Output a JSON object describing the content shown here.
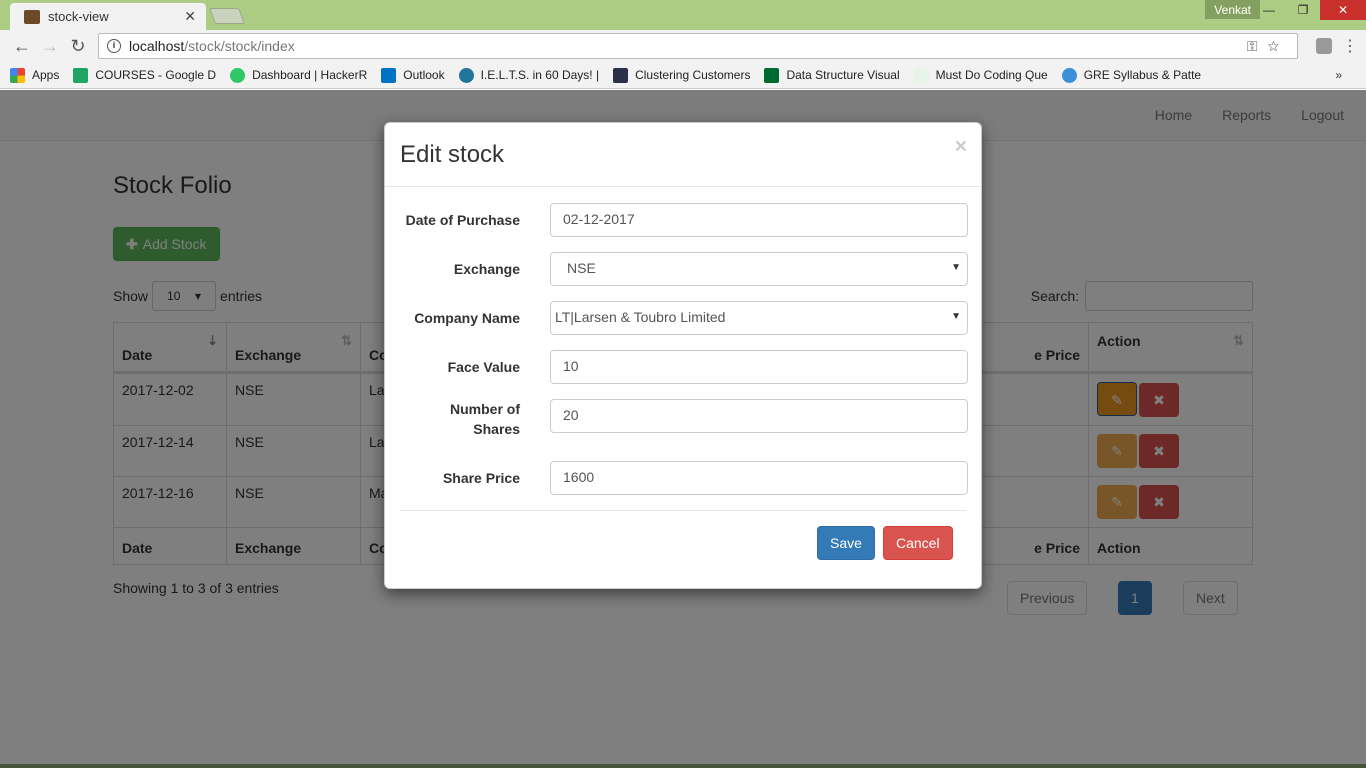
{
  "browser": {
    "tab_title": "stock-view",
    "user": "Venkat",
    "url_host": "localhost",
    "url_path": "/stock/stock/index",
    "bookmarks": [
      {
        "label": "Apps",
        "color": "#e94235"
      },
      {
        "label": "COURSES - Google D",
        "color": "#1fa463"
      },
      {
        "label": "Dashboard | HackerR",
        "color": "#2ec866"
      },
      {
        "label": "Outlook",
        "color": "#0072c6"
      },
      {
        "label": "I.E.L.T.S. in 60 Days! |",
        "color": "#21759b"
      },
      {
        "label": "Clustering Customers",
        "color": "#2a2f4a"
      },
      {
        "label": "Data Structure Visual",
        "color": "#006a33"
      },
      {
        "label": "Must Do Coding Que",
        "color": "#2f8d46"
      },
      {
        "label": "GRE Syllabus & Patte",
        "color": "#3a8fd8"
      }
    ],
    "more": "»"
  },
  "navbar": {
    "links": [
      "Home",
      "Reports",
      "Logout"
    ]
  },
  "page": {
    "title": "Stock Folio",
    "add_label": "Add Stock",
    "show_label": "Show",
    "entries_label": "entries",
    "page_length": "10",
    "search_label": "Search:"
  },
  "table": {
    "headers": [
      "Date",
      "Exchange",
      "Co",
      "e Price",
      "Action"
    ],
    "rows": [
      [
        "2017-12-02",
        "NSE",
        "La"
      ],
      [
        "2017-12-14",
        "NSE",
        "La"
      ],
      [
        "2017-12-16",
        "NSE",
        "Ma"
      ]
    ],
    "info": "Showing 1 to 3 of 3 entries",
    "pagination": {
      "previous": "Previous",
      "current": "1",
      "next": "Next"
    }
  },
  "modal": {
    "title": "Edit stock",
    "close": "×",
    "fields": [
      {
        "label": "Date of Purchase",
        "value": "02-12-2017"
      },
      {
        "label": "Exchange",
        "value": "NSE"
      },
      {
        "label": "Company Name",
        "value": "LT|Larsen & Toubro Limited"
      },
      {
        "label": "Face Value",
        "value": "10"
      },
      {
        "label": "Number of Shares",
        "value": "20"
      },
      {
        "label": "Share Price",
        "value": "1600"
      }
    ],
    "save": "Save",
    "cancel": "Cancel"
  }
}
